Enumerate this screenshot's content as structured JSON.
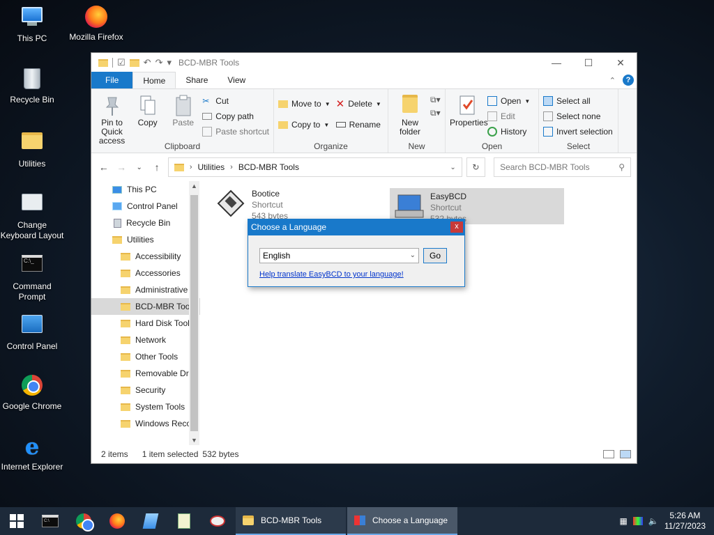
{
  "desktop": {
    "icons": [
      {
        "label": "This PC"
      },
      {
        "label": "Mozilla Firefox"
      },
      {
        "label": "Recycle Bin"
      },
      {
        "label": "Utilities"
      },
      {
        "label": "Change Keyboard Layout"
      },
      {
        "label": "Command Prompt"
      },
      {
        "label": "Control Panel"
      },
      {
        "label": "Google Chrome"
      },
      {
        "label": "Internet Explorer"
      }
    ]
  },
  "explorer": {
    "title": "BCD-MBR Tools",
    "tabs": {
      "file": "File",
      "home": "Home",
      "share": "Share",
      "view": "View"
    },
    "ribbon": {
      "clipboard": {
        "label": "Clipboard",
        "pin": "Pin to Quick access",
        "copy": "Copy",
        "paste": "Paste",
        "cut": "Cut",
        "copy_path": "Copy path",
        "paste_shortcut": "Paste shortcut"
      },
      "organize": {
        "label": "Organize",
        "move_to": "Move to",
        "copy_to": "Copy to",
        "delete": "Delete",
        "rename": "Rename"
      },
      "new": {
        "label": "New",
        "new_folder": "New folder"
      },
      "open": {
        "label": "Open",
        "properties": "Properties",
        "open": "Open",
        "edit": "Edit",
        "history": "History"
      },
      "select": {
        "label": "Select",
        "select_all": "Select all",
        "select_none": "Select none",
        "invert": "Invert selection"
      }
    },
    "address": {
      "crumbs": [
        "Utilities",
        "BCD-MBR Tools"
      ]
    },
    "search": {
      "placeholder": "Search BCD-MBR Tools"
    },
    "nav": [
      {
        "label": "This PC"
      },
      {
        "label": "Control Panel"
      },
      {
        "label": "Recycle Bin"
      },
      {
        "label": "Utilities"
      },
      {
        "label": "Accessibility"
      },
      {
        "label": "Accessories"
      },
      {
        "label": "Administrative"
      },
      {
        "label": "BCD-MBR Tools"
      },
      {
        "label": "Hard Disk Tools"
      },
      {
        "label": "Network"
      },
      {
        "label": "Other Tools"
      },
      {
        "label": "Removable Dri"
      },
      {
        "label": "Security"
      },
      {
        "label": "System Tools"
      },
      {
        "label": "Windows Reco"
      }
    ],
    "files": [
      {
        "name": "Bootice",
        "type": "Shortcut",
        "size": "543 bytes"
      },
      {
        "name": "EasyBCD",
        "type": "Shortcut",
        "size": "532 bytes"
      }
    ],
    "status": {
      "count": "2 items",
      "selected": "1 item selected",
      "size": "532 bytes"
    }
  },
  "dialog": {
    "title": "Choose a Language",
    "language": "English",
    "go": "Go",
    "link": "Help translate EasyBCD to your language!"
  },
  "taskbar": {
    "tasks": [
      {
        "label": "BCD-MBR Tools"
      },
      {
        "label": "Choose a Language"
      }
    ],
    "time": "5:26 AM",
    "date": "11/27/2023"
  }
}
